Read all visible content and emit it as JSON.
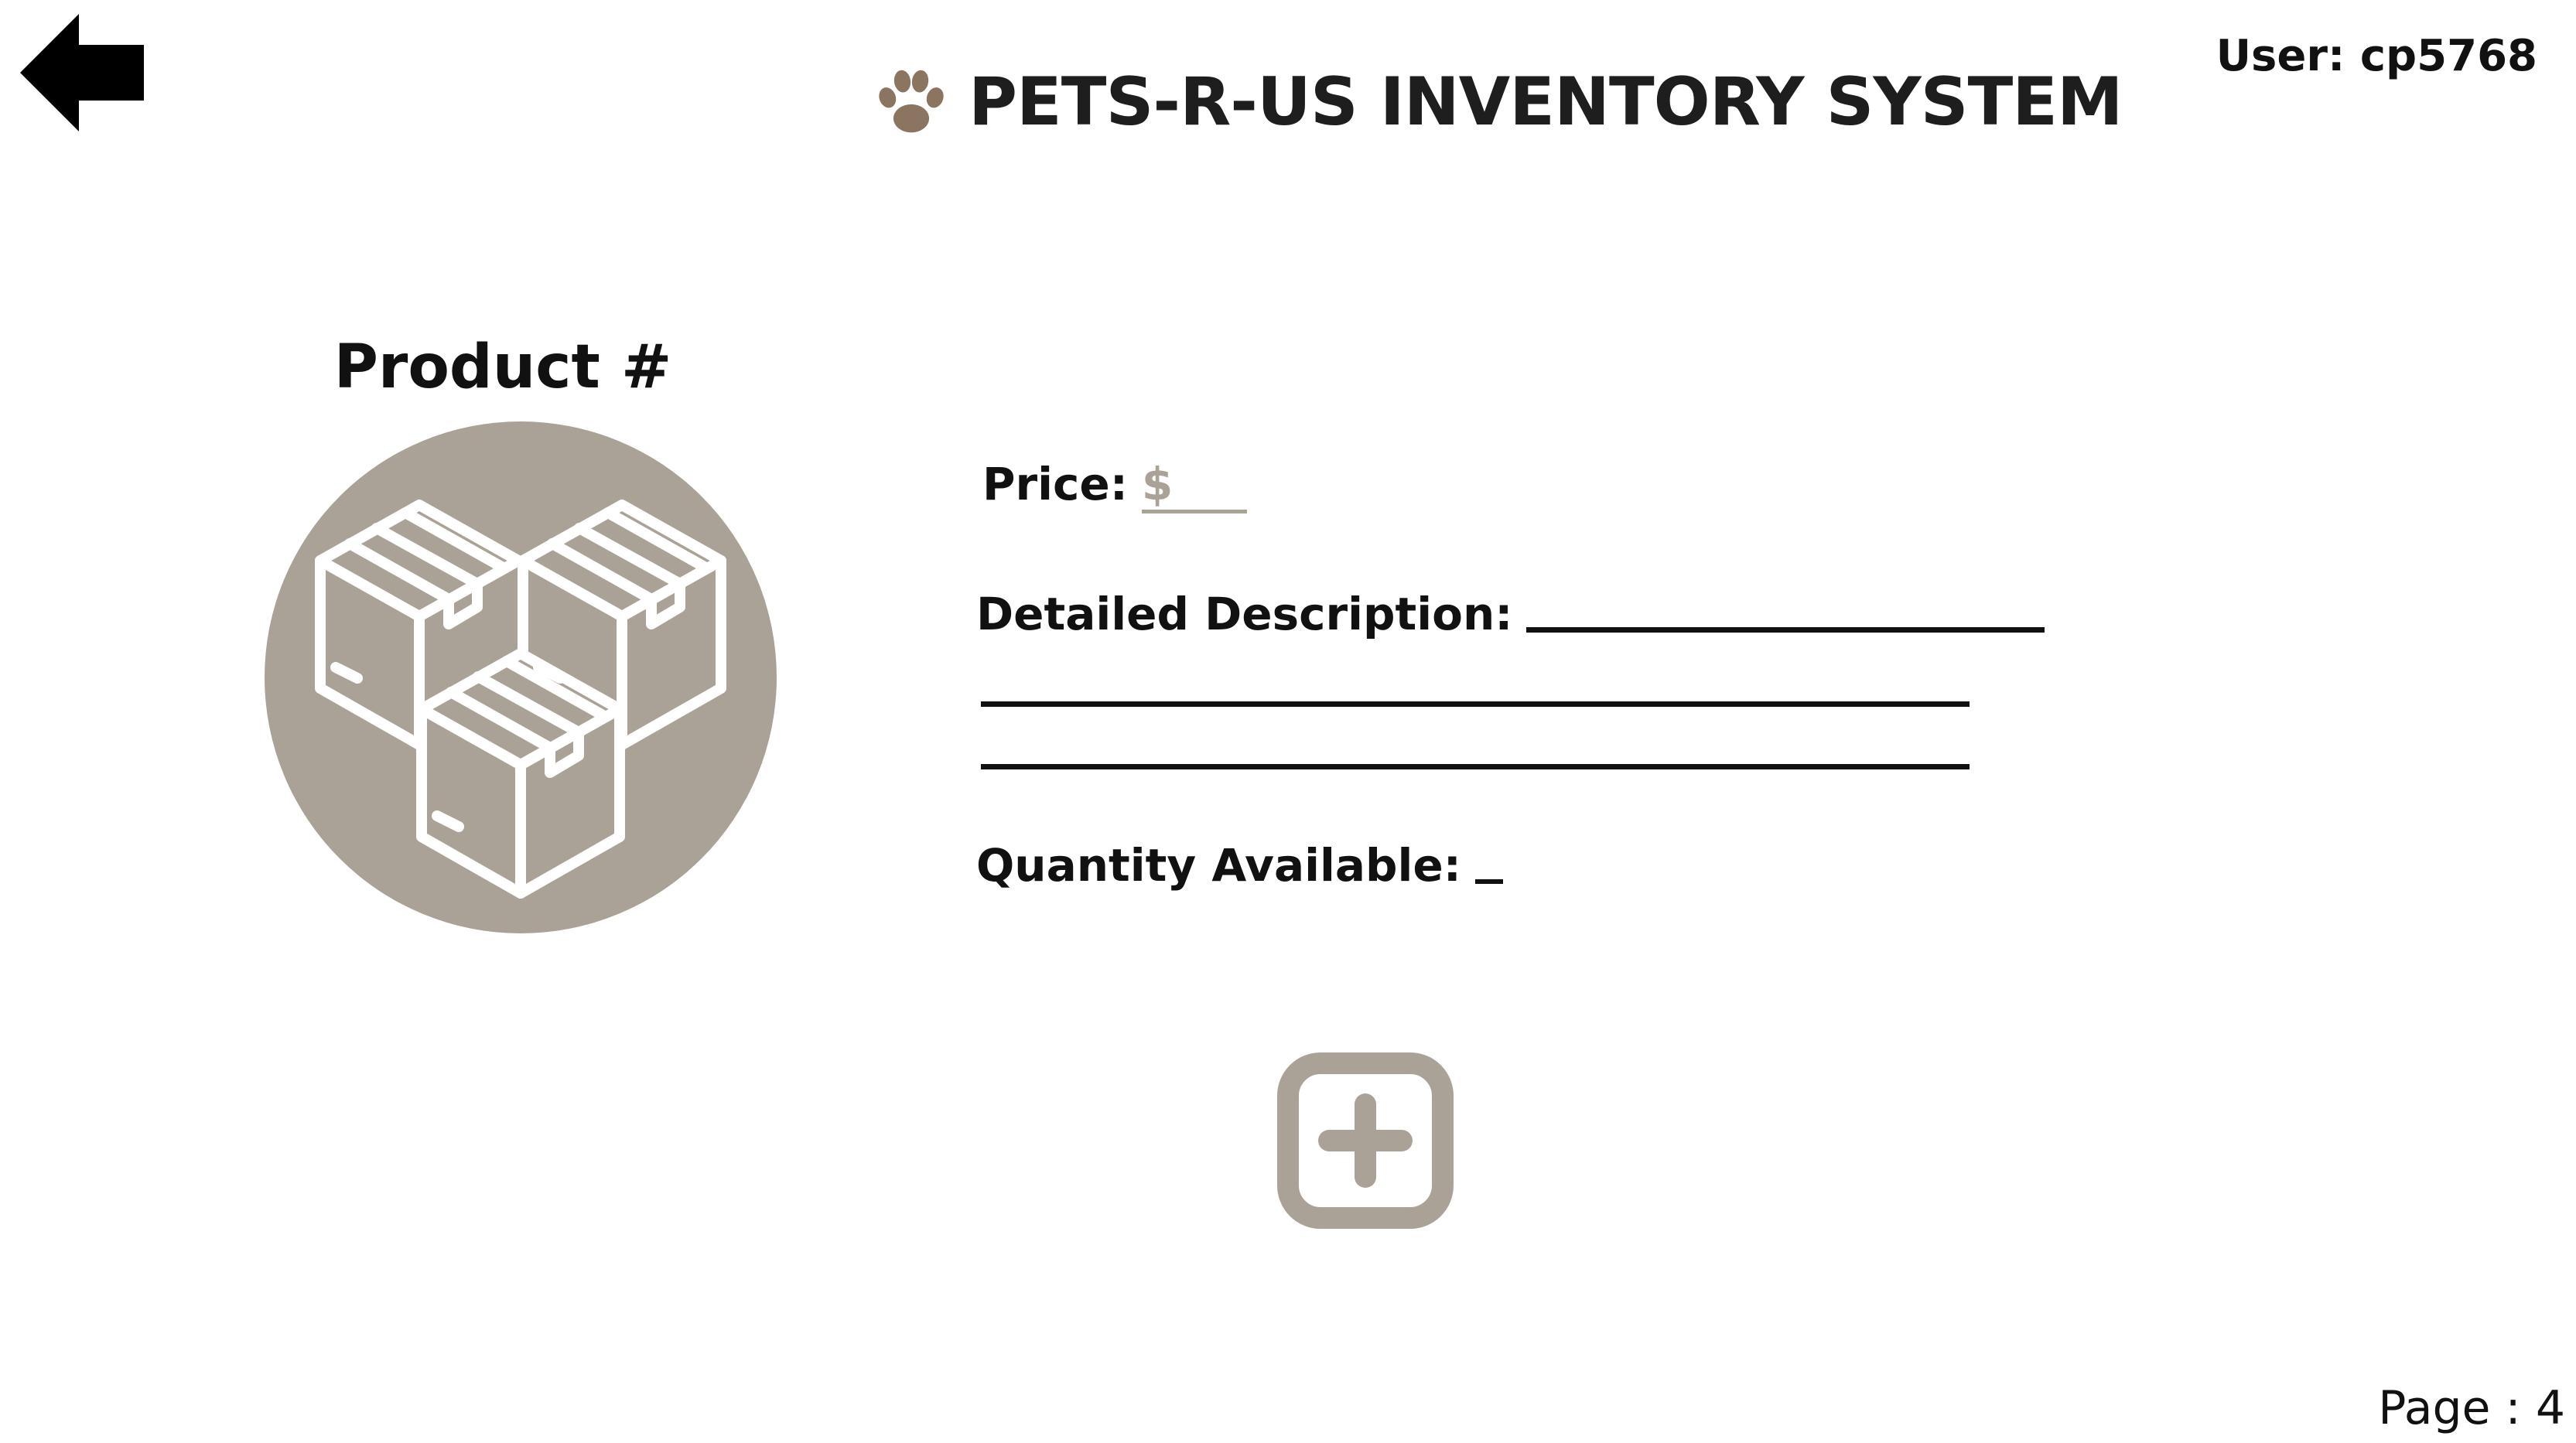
{
  "header": {
    "title": "PETS-R-US INVENTORY SYSTEM",
    "user": "User: cp5768",
    "back_icon": "arrow-left-icon",
    "logo_icon": "paw-icon"
  },
  "product": {
    "title": "Product #",
    "image_icon": "stacked-boxes-icon"
  },
  "form": {
    "price_label": "Price:",
    "price_value": "$",
    "description_label": "Detailed Description:",
    "quantity_label": "Quantity Available:"
  },
  "actions": {
    "add_icon": "plus-square-icon"
  },
  "footer": {
    "page": "Page : 4"
  },
  "colors": {
    "accent": "#aaa297",
    "paw": "#8c7560",
    "text": "#111111"
  }
}
